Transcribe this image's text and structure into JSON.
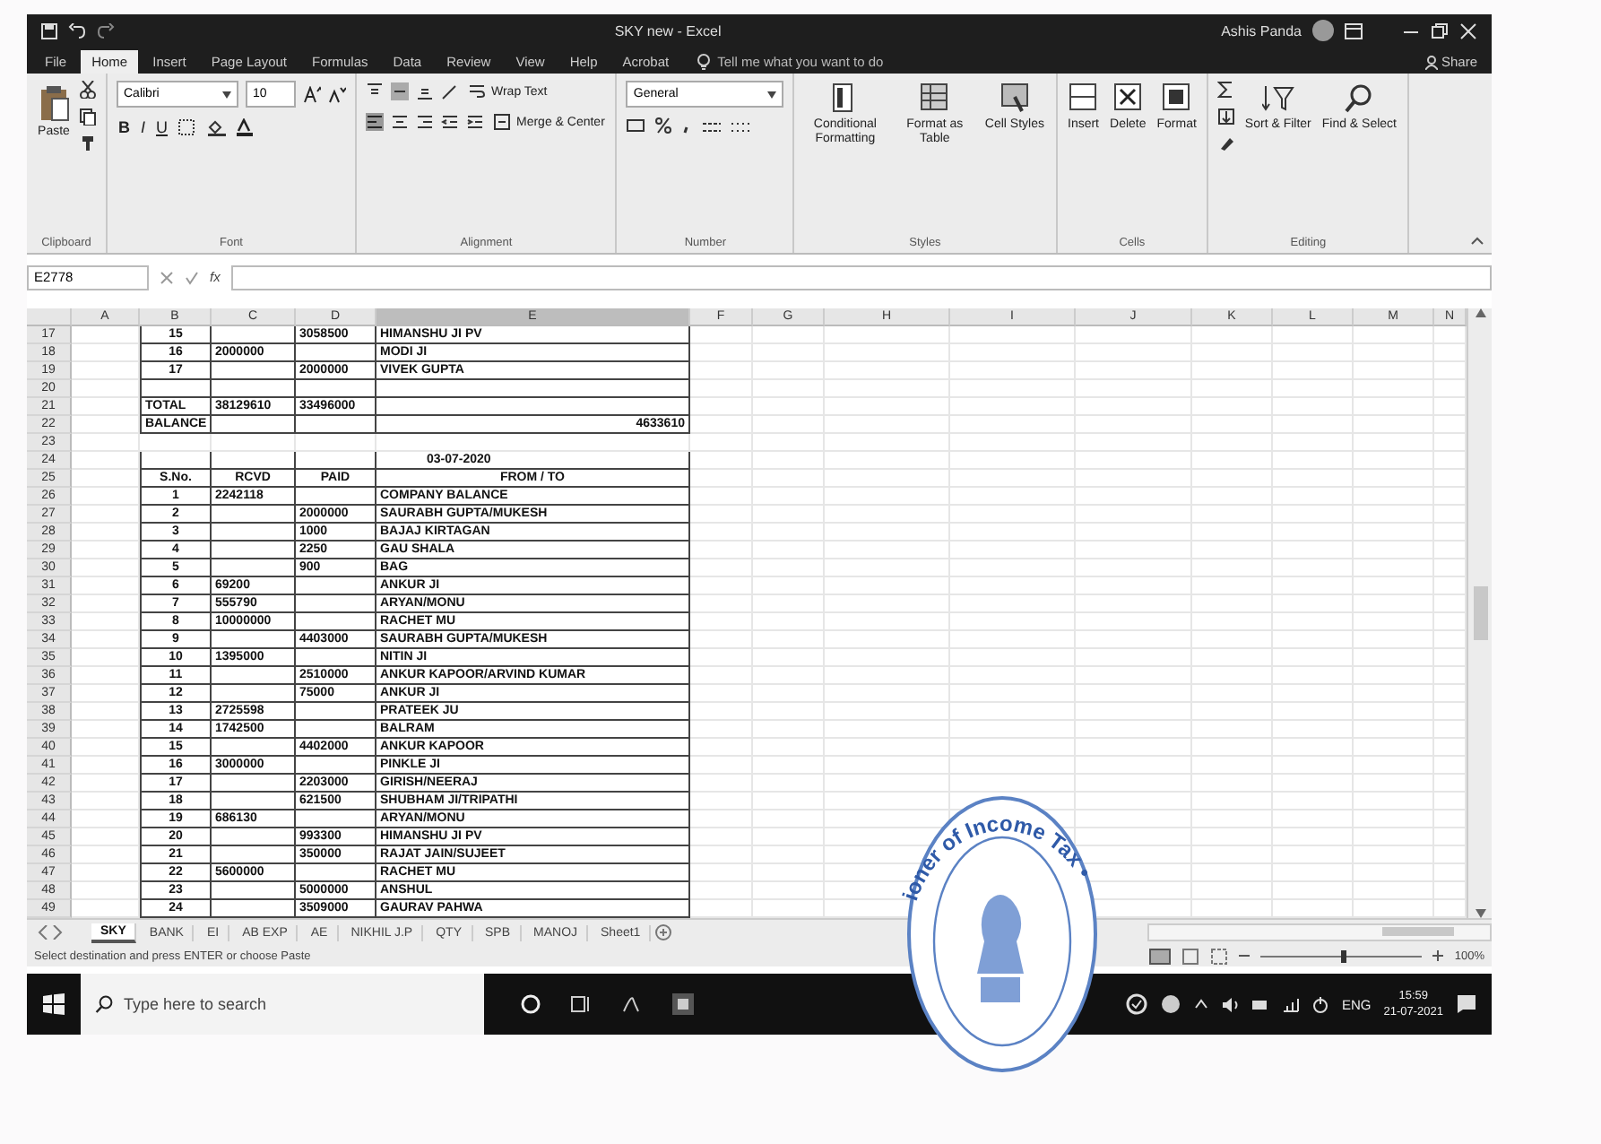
{
  "window": {
    "title": "SKY new - Excel",
    "user": "Ashis Panda"
  },
  "ribbon_tabs": [
    {
      "label": "File",
      "selected": false
    },
    {
      "label": "Home",
      "selected": true
    },
    {
      "label": "Insert",
      "selected": false
    },
    {
      "label": "Page Layout",
      "selected": false
    },
    {
      "label": "Formulas",
      "selected": false
    },
    {
      "label": "Data",
      "selected": false
    },
    {
      "label": "Review",
      "selected": false
    },
    {
      "label": "View",
      "selected": false
    },
    {
      "label": "Help",
      "selected": false
    },
    {
      "label": "Acrobat",
      "selected": false
    }
  ],
  "tell_me": {
    "placeholder": "Tell me what you want to do"
  },
  "share": "Share",
  "ribbon_groups": [
    {
      "kind": "clipboard",
      "name": "Clipboard",
      "buttons": [
        "Paste"
      ]
    },
    {
      "kind": "font",
      "name": "Font",
      "font": "Calibri",
      "size": "10",
      "buttons": [
        "B",
        "I",
        "U"
      ]
    },
    {
      "kind": "alignment",
      "name": "Alignment",
      "buttons": [
        "Wrap Text",
        "Merge & Center"
      ]
    },
    {
      "kind": "number",
      "name": "Number",
      "format": "General"
    },
    {
      "kind": "styles",
      "name": "Styles",
      "buttons": [
        "Conditional Formatting",
        "Format as Table",
        "Cell Styles"
      ]
    },
    {
      "kind": "cells",
      "name": "Cells",
      "buttons": [
        "Insert",
        "Delete",
        "Format"
      ]
    },
    {
      "kind": "editing",
      "name": "Editing",
      "buttons": [
        "Sort & Filter",
        "Find & Select"
      ]
    }
  ],
  "formula_bar": {
    "name_box": "E2778",
    "fx": "fx"
  },
  "columns": [
    {
      "label": "A",
      "selected": false
    },
    {
      "label": "B",
      "selected": false
    },
    {
      "label": "C",
      "selected": false
    },
    {
      "label": "D",
      "selected": false
    },
    {
      "label": "E",
      "selected": true
    },
    {
      "label": "F",
      "selected": false
    },
    {
      "label": "G",
      "selected": false
    },
    {
      "label": "H",
      "selected": false
    },
    {
      "label": "I",
      "selected": false
    },
    {
      "label": "J",
      "selected": false
    },
    {
      "label": "K",
      "selected": false
    },
    {
      "label": "L",
      "selected": false
    },
    {
      "label": "M",
      "selected": false
    },
    {
      "label": "N",
      "selected": false
    }
  ],
  "rows": [
    {
      "row": "17",
      "kind": "entry",
      "sno": "15",
      "paid": "3058500",
      "name": "HIMANSHU JI PV"
    },
    {
      "row": "18",
      "kind": "entry",
      "sno": "16",
      "rcvd": "2000000",
      "name": "MODI JI"
    },
    {
      "row": "19",
      "kind": "entry",
      "sno": "17",
      "paid": "2000000",
      "name": "VIVEK GUPTA"
    },
    {
      "row": "20",
      "kind": "blank"
    },
    {
      "row": "21",
      "kind": "total",
      "label": "TOTAL",
      "rcvd": "38129610",
      "paid": "33496000"
    },
    {
      "row": "22",
      "kind": "balance",
      "label": "BALANCE",
      "amount": "4633610"
    },
    {
      "row": "23",
      "kind": "gap"
    },
    {
      "row": "24",
      "kind": "date",
      "date": "03-07-2020"
    },
    {
      "row": "25",
      "kind": "header",
      "sno": "S.No.",
      "rcvd": "RCVD",
      "paid": "PAID",
      "name": "FROM / TO"
    },
    {
      "row": "26",
      "kind": "entry",
      "sno": "1",
      "rcvd": "2242118",
      "name": "COMPANY BALANCE"
    },
    {
      "row": "27",
      "kind": "entry",
      "sno": "2",
      "paid": "2000000",
      "name": "SAURABH GUPTA/MUKESH"
    },
    {
      "row": "28",
      "kind": "entry",
      "sno": "3",
      "paid": "1000",
      "name": "BAJAJ KIRTAGAN"
    },
    {
      "row": "29",
      "kind": "entry",
      "sno": "4",
      "paid": "2250",
      "name": "GAU SHALA"
    },
    {
      "row": "30",
      "kind": "entry",
      "sno": "5",
      "paid": "900",
      "name": "BAG"
    },
    {
      "row": "31",
      "kind": "entry",
      "sno": "6",
      "rcvd": "69200",
      "name": "ANKUR JI"
    },
    {
      "row": "32",
      "kind": "entry",
      "sno": "7",
      "rcvd": "555790",
      "name": "ARYAN/MONU"
    },
    {
      "row": "33",
      "kind": "entry",
      "sno": "8",
      "rcvd": "10000000",
      "name": "RACHET MU"
    },
    {
      "row": "34",
      "kind": "entry",
      "sno": "9",
      "paid": "4403000",
      "name": "SAURABH GUPTA/MUKESH"
    },
    {
      "row": "35",
      "kind": "entry",
      "sno": "10",
      "rcvd": "1395000",
      "name": "NITIN JI"
    },
    {
      "row": "36",
      "kind": "entry",
      "sno": "11",
      "paid": "2510000",
      "name": "ANKUR KAPOOR/ARVIND KUMAR"
    },
    {
      "row": "37",
      "kind": "entry",
      "sno": "12",
      "paid": "75000",
      "name": "ANKUR JI"
    },
    {
      "row": "38",
      "kind": "entry",
      "sno": "13",
      "rcvd": "2725598",
      "name": "PRATEEK JU"
    },
    {
      "row": "39",
      "kind": "entry",
      "sno": "14",
      "rcvd": "1742500",
      "name": "BALRAM"
    },
    {
      "row": "40",
      "kind": "entry",
      "sno": "15",
      "paid": "4402000",
      "name": "ANKUR KAPOOR"
    },
    {
      "row": "41",
      "kind": "entry",
      "sno": "16",
      "rcvd": "3000000",
      "name": "PINKLE JI"
    },
    {
      "row": "42",
      "kind": "entry",
      "sno": "17",
      "paid": "2203000",
      "name": "GIRISH/NEERAJ"
    },
    {
      "row": "43",
      "kind": "entry",
      "sno": "18",
      "paid": "621500",
      "name": "SHUBHAM JI/TRIPATHI"
    },
    {
      "row": "44",
      "kind": "entry",
      "sno": "19",
      "rcvd": "686130",
      "name": "ARYAN/MONU"
    },
    {
      "row": "45",
      "kind": "entry",
      "sno": "20",
      "paid": "993300",
      "name": "HIMANSHU JI PV"
    },
    {
      "row": "46",
      "kind": "entry",
      "sno": "21",
      "paid": "350000",
      "name": "RAJAT JAIN/SUJEET"
    },
    {
      "row": "47",
      "kind": "entry",
      "sno": "22",
      "rcvd": "5600000",
      "name": "RACHET MU"
    },
    {
      "row": "48",
      "kind": "entry",
      "sno": "23",
      "paid": "5000000",
      "name": "ANSHUL"
    },
    {
      "row": "49",
      "kind": "entry",
      "sno": "24",
      "paid": "3509000",
      "name": "GAURAV PAHWA"
    }
  ],
  "sheet_tabs": [
    {
      "label": "SKY",
      "selected": true
    },
    {
      "label": "BANK",
      "selected": false
    },
    {
      "label": "EI",
      "selected": false
    },
    {
      "label": "AB EXP",
      "selected": false
    },
    {
      "label": "AE",
      "selected": false
    },
    {
      "label": "NIKHIL J.P",
      "selected": false
    },
    {
      "label": "QTY",
      "selected": false
    },
    {
      "label": "SPB",
      "selected": false
    },
    {
      "label": "MANOJ",
      "selected": false
    },
    {
      "label": "Sheet1",
      "selected": false
    }
  ],
  "status_bar": {
    "message": "Select destination and press ENTER or choose Paste",
    "zoom": "100%",
    "zoom_slider": {
      "level": 0.5
    }
  },
  "stamp": {
    "text": "ioner of Income Tax •"
  },
  "taskbar": {
    "search": {
      "placeholder": "Type here to search"
    },
    "language": "ENG",
    "time": "15:59",
    "date": "21-07-2021"
  }
}
